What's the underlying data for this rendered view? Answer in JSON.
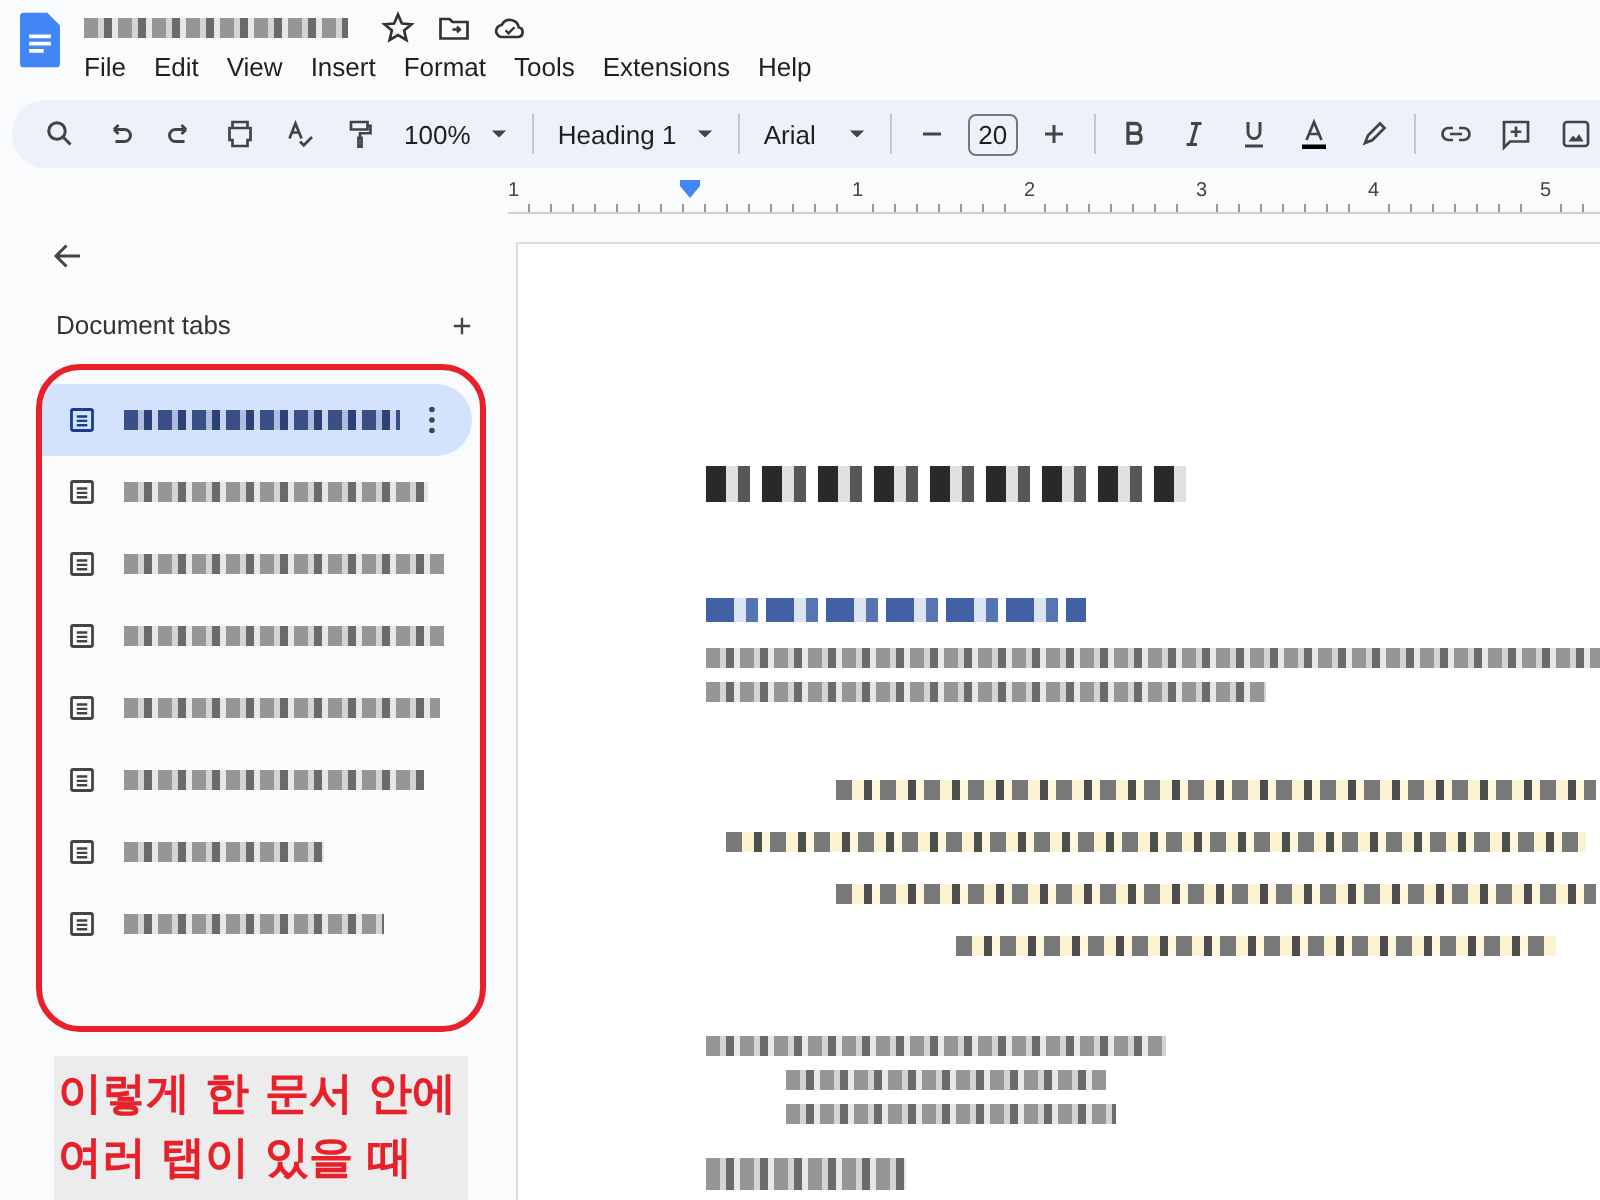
{
  "menu": [
    {
      "label": "File"
    },
    {
      "label": "Edit"
    },
    {
      "label": "View"
    },
    {
      "label": "Insert"
    },
    {
      "label": "Format"
    },
    {
      "label": "Tools"
    },
    {
      "label": "Extensions"
    },
    {
      "label": "Help"
    }
  ],
  "toolbar": {
    "zoom": "100%",
    "style": "Heading 1",
    "font": "Arial",
    "font_size": "20"
  },
  "ruler": {
    "marks": [
      "1",
      "1",
      "2",
      "3",
      "4",
      "5"
    ]
  },
  "sidebar": {
    "title": "Document tabs",
    "tabs": [
      {
        "selected": true
      },
      {
        "selected": false
      },
      {
        "selected": false
      },
      {
        "selected": false
      },
      {
        "selected": false
      },
      {
        "selected": false
      },
      {
        "selected": false
      },
      {
        "selected": false
      }
    ]
  },
  "annotation": {
    "lines": [
      "이렇게 한 문서 안에",
      "여러 탭이 있을 때"
    ]
  }
}
